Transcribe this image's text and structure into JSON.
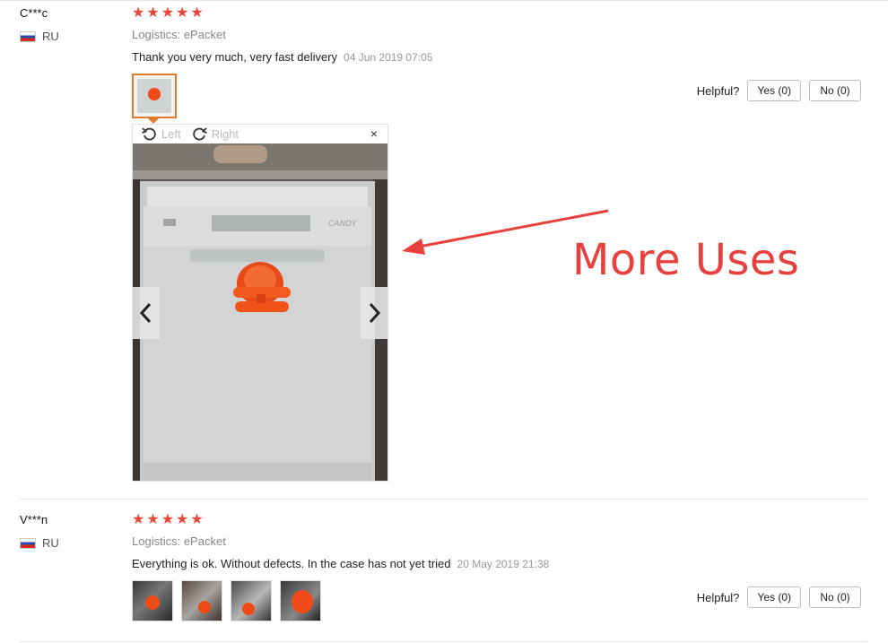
{
  "reviews": [
    {
      "username": "C***c",
      "country": "RU",
      "stars": 5,
      "logistics_label": "Logistics:",
      "logistics_value": "ePacket",
      "text": "Thank you very much, very fast delivery",
      "date": "04 Jun 2019 07:05",
      "helpful_label": "Helpful?",
      "yes_label": "Yes (0)",
      "no_label": "No (0)"
    },
    {
      "username": "V***n",
      "country": "RU",
      "stars": 5,
      "logistics_label": "Logistics:",
      "logistics_value": "ePacket",
      "text": "Everything is ok. Without defects. In the case has not yet tried",
      "date": "20 May 2019 21:38",
      "helpful_label": "Helpful?",
      "yes_label": "Yes (0)",
      "no_label": "No (0)"
    }
  ],
  "viewer": {
    "rotate_left_label": "Left",
    "rotate_right_label": "Right",
    "close_symbol": "×",
    "prev_icon": "chevron-left-icon",
    "next_icon": "chevron-right-icon",
    "photo_brand": "CANDY"
  },
  "annotation": {
    "text": "More Uses",
    "color": "#e8403c"
  },
  "colors": {
    "star": "#e6473b",
    "active_thumb_border": "#e07a2e",
    "suction_cup": "#f04a18"
  }
}
